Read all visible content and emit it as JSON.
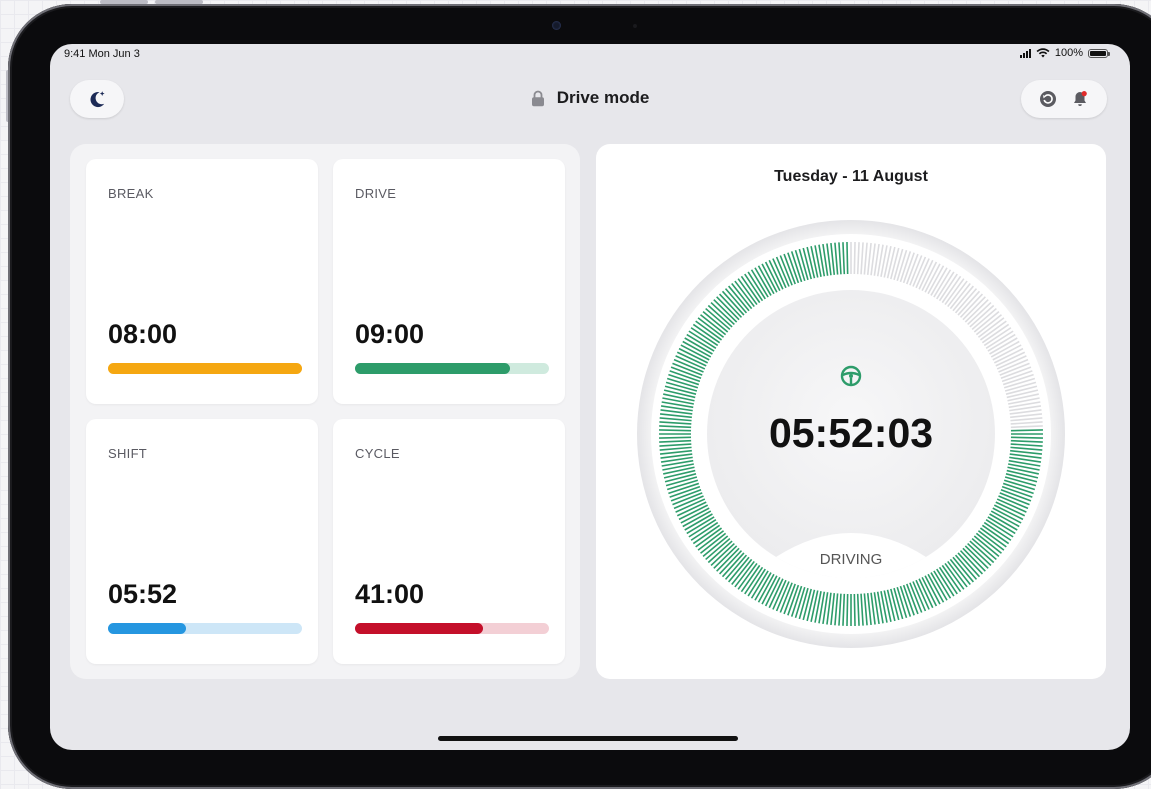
{
  "status_bar": {
    "time": "9:41 Mon Jun 3",
    "battery": "100%"
  },
  "header": {
    "title": "Drive mode",
    "theme_icon": "moon-stars-icon",
    "lock_icon": "lock-icon",
    "history_icon": "history-icon",
    "bell_icon": "bell-icon"
  },
  "cards": [
    {
      "label": "BREAK",
      "value": "08:00",
      "progress": 1.0,
      "color": "#f5a711",
      "track": "#fde7c0"
    },
    {
      "label": "DRIVE",
      "value": "09:00",
      "progress": 0.8,
      "color": "#2d9c6a",
      "track": "#cfeade"
    },
    {
      "label": "SHIFT",
      "value": "05:52",
      "progress": 0.4,
      "color": "#2596e0",
      "track": "#cde6f7"
    },
    {
      "label": "CYCLE",
      "value": "41:00",
      "progress": 0.66,
      "color": "#c40f2a",
      "track": "#f3cfd5"
    }
  ],
  "dial": {
    "date": "Tuesday - 11 August",
    "time": "05:52:03",
    "status": "DRIVING",
    "icon": "steering-wheel-icon",
    "active_color": "#2d9c6a",
    "inactive_color": "#dcdcdf",
    "filled_fraction": 0.756
  }
}
